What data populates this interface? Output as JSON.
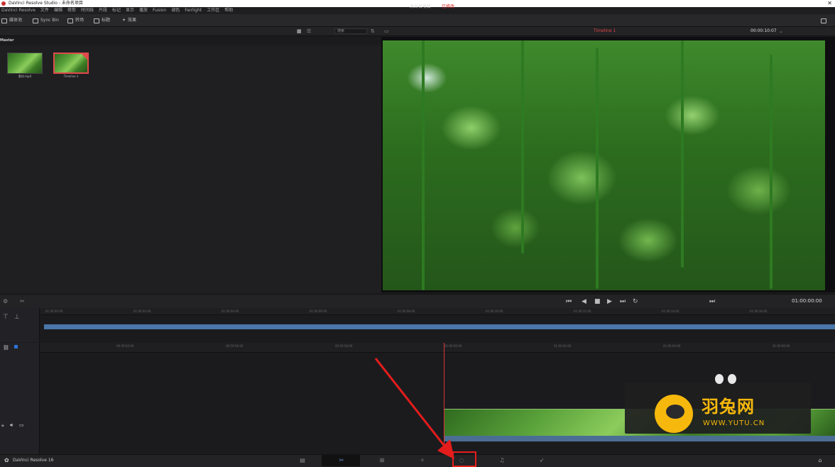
{
  "window": {
    "title": "DaVinci Resolve Studio - 未命名项目",
    "close_glyph": "✕"
  },
  "menu": [
    "DaVinci Resolve",
    "文件",
    "编辑",
    "修剪",
    "时间线",
    "片段",
    "标记",
    "显示",
    "播放",
    "Fusion",
    "调色",
    "Fairlight",
    "工作区",
    "帮助"
  ],
  "toolbar": {
    "media_pool": "媒体池",
    "sync_bin": "Sync Bin",
    "transitions": "转场",
    "titles": "标题",
    "effects": "效果"
  },
  "project": {
    "name": "未命名项目",
    "edited": "已修改"
  },
  "media": {
    "search_placeholder": "搜索",
    "bin": "Master",
    "clips": [
      {
        "name": "素材.mp4"
      },
      {
        "name": "Timeline 1"
      }
    ]
  },
  "viewer": {
    "timeline_name": "Timeline 1",
    "duration_tc": "00:00:10:07",
    "current_tc": "01:00:00:00"
  },
  "timeline": {
    "mini_ruler": [
      "01:00:00:00",
      "01:00:02:00",
      "01:00:04:00",
      "01:00:06:00",
      "01:00:08:00",
      "01:00:10:00",
      "01:00:12:00",
      "01:00:14:00",
      "01:00:16:00"
    ],
    "main_ruler": [
      "00:59:54:00",
      "00:59:56:00",
      "00:59:58:00",
      "01:00:00:00",
      "01:00:02:00",
      "01:00:04:00",
      "01:00:06:00"
    ]
  },
  "watermark": {
    "name": "羽兔网",
    "url": "WWW.YUTU.CN"
  },
  "bottom": {
    "app": "DaVinci Resolve 16"
  },
  "pages": [
    "media-page-icon",
    "cut-page-icon",
    "edit-page-icon",
    "fusion-page-icon",
    "color-page-icon",
    "fairlight-page-icon",
    "deliver-page-icon"
  ]
}
